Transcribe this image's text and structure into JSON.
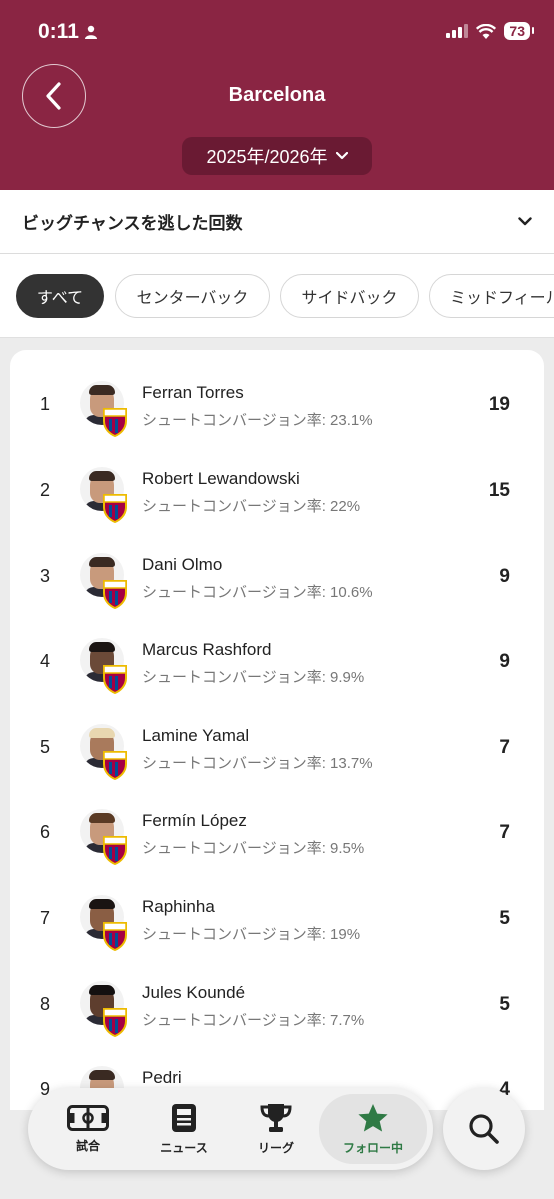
{
  "status": {
    "time": "0:11",
    "battery": "73"
  },
  "header": {
    "title": "Barcelona",
    "season": "2025年/2026年"
  },
  "stat_selector": {
    "label": "ビッグチャンスを逃した回数"
  },
  "filters": [
    "すべて",
    "センターバック",
    "サイドバック",
    "ミッドフィール"
  ],
  "players": [
    {
      "rank": "1",
      "name": "Ferran Torres",
      "sub": "シュートコンバージョン率: 23.1%",
      "value": "19"
    },
    {
      "rank": "2",
      "name": "Robert Lewandowski",
      "sub": "シュートコンバージョン率: 22%",
      "value": "15"
    },
    {
      "rank": "3",
      "name": "Dani Olmo",
      "sub": "シュートコンバージョン率: 10.6%",
      "value": "9"
    },
    {
      "rank": "4",
      "name": "Marcus Rashford",
      "sub": "シュートコンバージョン率: 9.9%",
      "value": "9"
    },
    {
      "rank": "5",
      "name": "Lamine Yamal",
      "sub": "シュートコンバージョン率: 13.7%",
      "value": "7"
    },
    {
      "rank": "6",
      "name": "Fermín López",
      "sub": "シュートコンバージョン率: 9.5%",
      "value": "7"
    },
    {
      "rank": "7",
      "name": "Raphinha",
      "sub": "シュートコンバージョン率: 19%",
      "value": "5"
    },
    {
      "rank": "8",
      "name": "Jules Koundé",
      "sub": "シュートコンバージョン率: 7.7%",
      "value": "5"
    },
    {
      "rank": "9",
      "name": "Pedri",
      "sub": "",
      "value": "4"
    }
  ],
  "nav": {
    "matches": "試合",
    "news": "ニュース",
    "leagues": "リーグ",
    "following": "フォロー中"
  },
  "colors": {
    "brand": "#8a2543",
    "active_nav": "#2f7a45"
  }
}
